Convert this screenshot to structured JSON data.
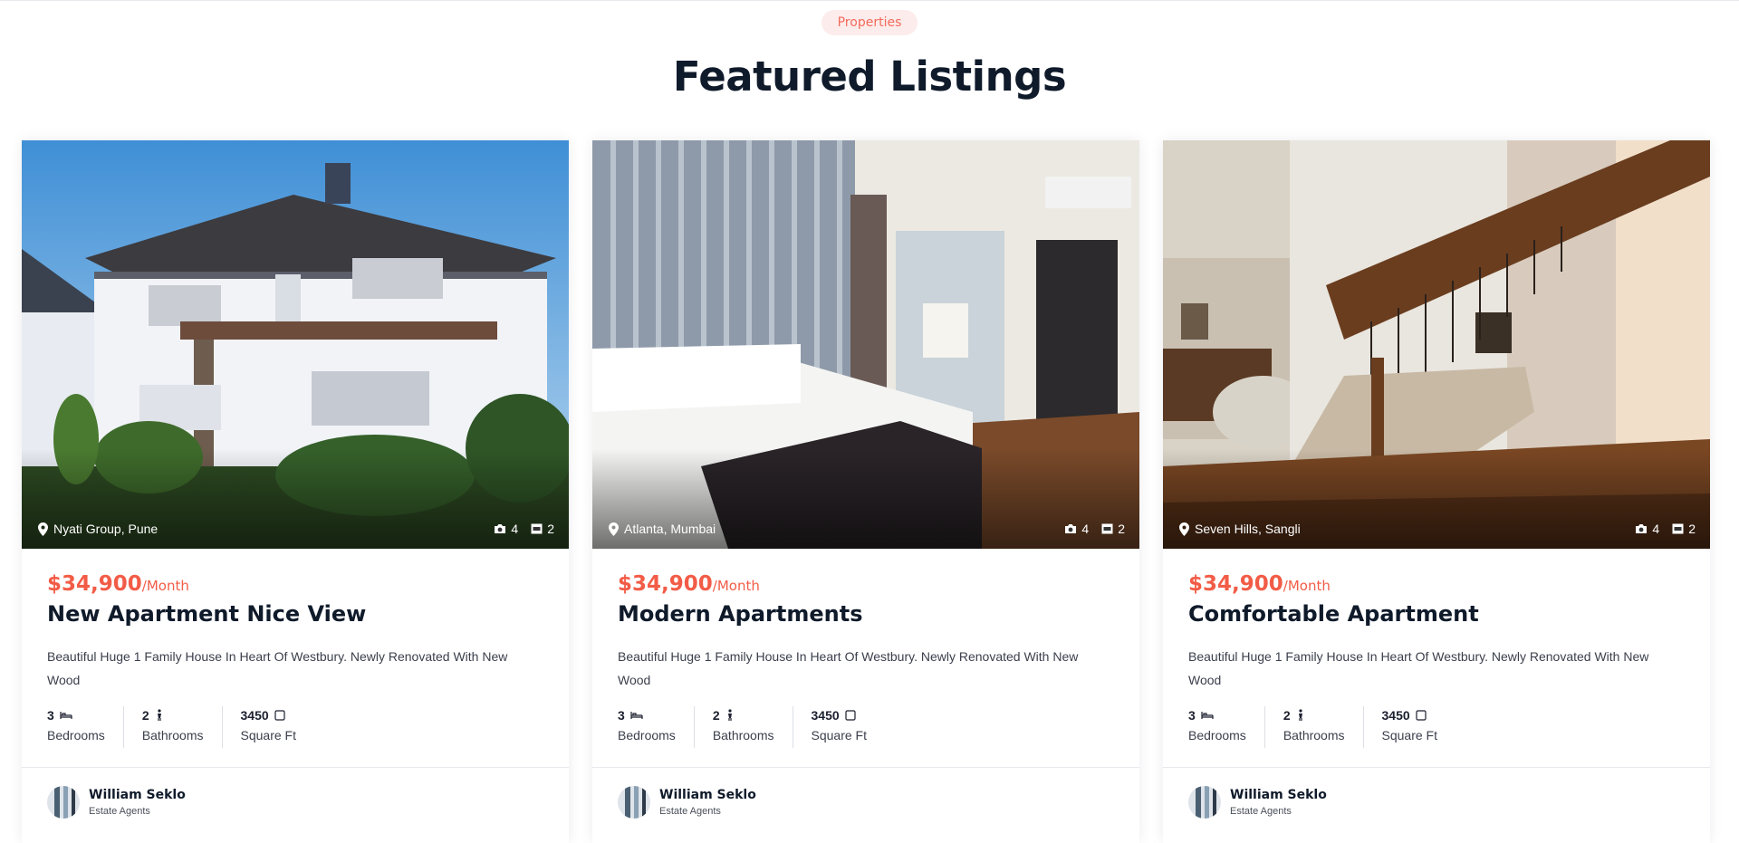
{
  "section": {
    "eyebrow": "Properties",
    "title": "Featured Listings"
  },
  "colors": {
    "accent": "#f25c47",
    "pill_bg": "#fdecec",
    "heading": "#0f1a2a"
  },
  "listings": [
    {
      "location": "Nyati Group, Pune",
      "photos": "4",
      "videos": "2",
      "price": "$34,900",
      "period": "/Month",
      "name": "New Apartment Nice View",
      "description": "Beautiful Huge 1 Family House In Heart Of Westbury. Newly Renovated With New Wood",
      "bedrooms": "3",
      "bedrooms_label": "Bedrooms",
      "bathrooms": "2",
      "bathrooms_label": "Bathrooms",
      "area": "3450",
      "area_label": "Square Ft",
      "agent_name": "William Seklo",
      "agent_role": "Estate Agents",
      "image_subject": "white two-story house exterior"
    },
    {
      "location": "Atlanta, Mumbai",
      "photos": "4",
      "videos": "2",
      "price": "$34,900",
      "period": "/Month",
      "name": "Modern Apartments",
      "description": "Beautiful Huge 1 Family House In Heart Of Westbury. Newly Renovated With New Wood",
      "bedrooms": "3",
      "bedrooms_label": "Bedrooms",
      "bathrooms": "2",
      "bathrooms_label": "Bathrooms",
      "area": "3450",
      "area_label": "Square Ft",
      "agent_name": "William Seklo",
      "agent_role": "Estate Agents",
      "image_subject": "modern hotel bedroom interior"
    },
    {
      "location": "Seven Hills, Sangli",
      "photos": "4",
      "videos": "2",
      "price": "$34,900",
      "period": "/Month",
      "name": "Comfortable Apartment",
      "description": "Beautiful Huge 1 Family House In Heart Of Westbury. Newly Renovated With New Wood",
      "bedrooms": "3",
      "bedrooms_label": "Bedrooms",
      "bathrooms": "2",
      "bathrooms_label": "Bathrooms",
      "area": "3450",
      "area_label": "Square Ft",
      "agent_name": "William Seklo",
      "agent_role": "Estate Agents",
      "image_subject": "living room with curved staircase"
    }
  ]
}
